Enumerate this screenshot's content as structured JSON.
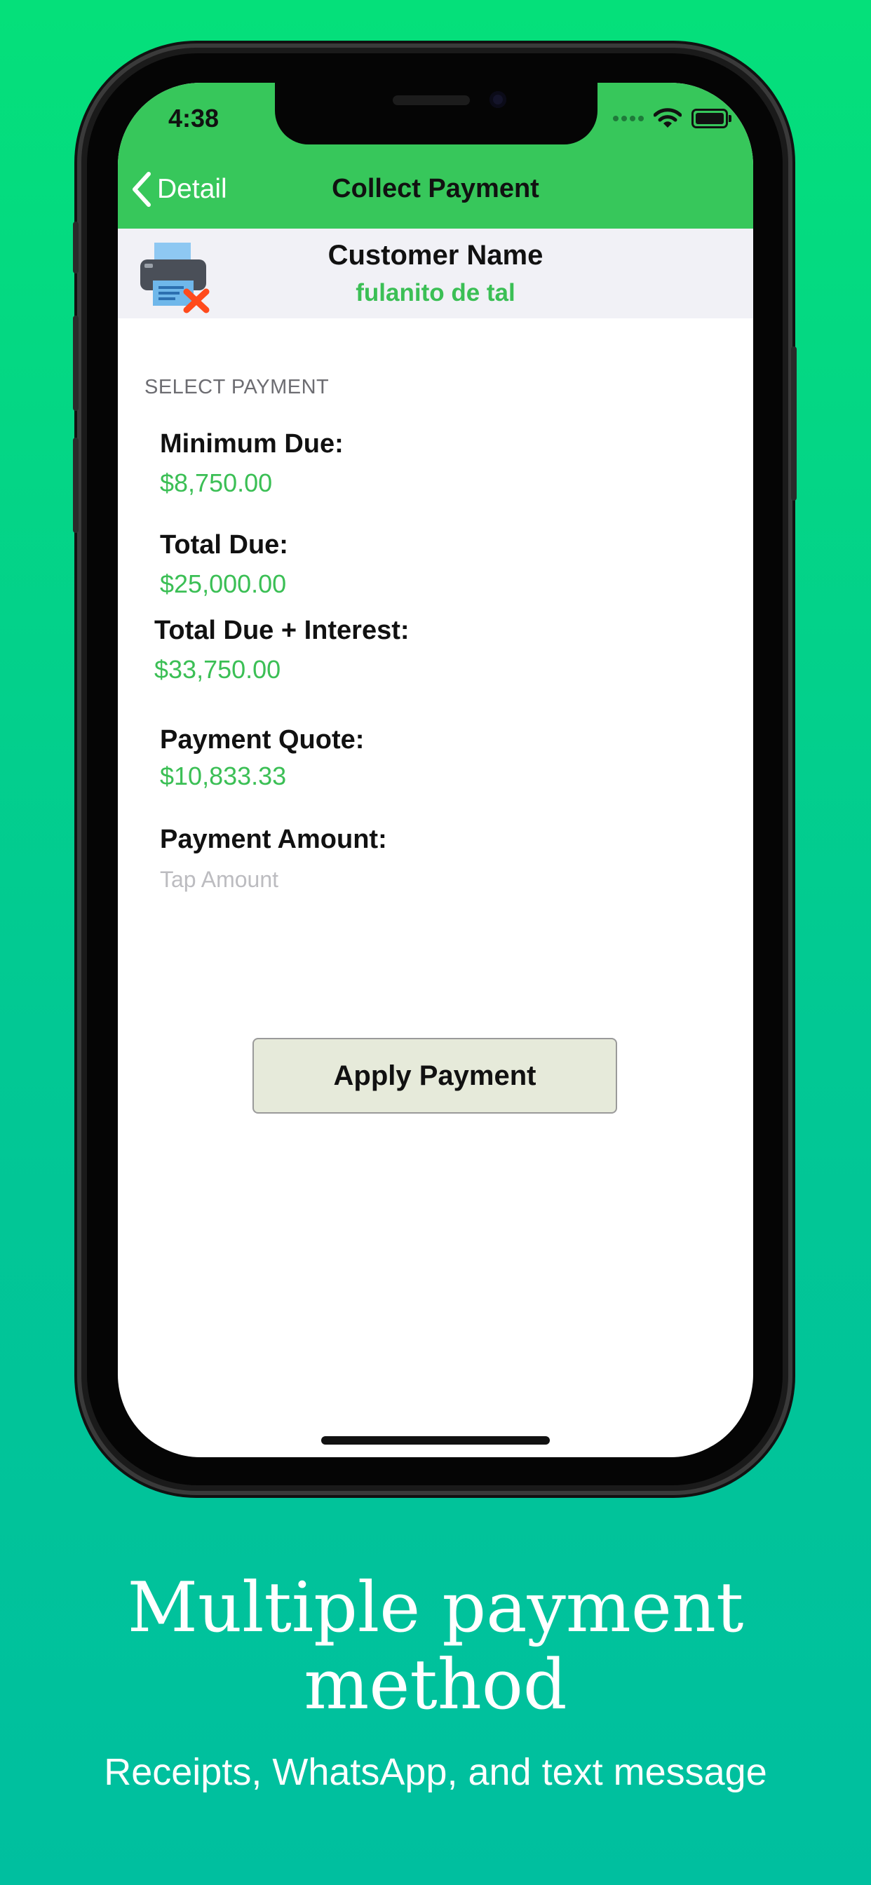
{
  "status_bar": {
    "time": "4:38"
  },
  "nav": {
    "back_label": "Detail",
    "title": "Collect Payment"
  },
  "customer": {
    "label": "Customer Name",
    "name": "fulanito de tal"
  },
  "section": {
    "header": "SELECT PAYMENT"
  },
  "fields": [
    {
      "label": "Minimum Due:",
      "value": "$8,750.00"
    },
    {
      "label": "Total Due:",
      "value": "$25,000.00"
    },
    {
      "label": "Total Due + Interest:",
      "value": "$33,750.00"
    },
    {
      "label": "Payment Quote:",
      "value": "$10,833.33"
    }
  ],
  "payment_amount": {
    "label": "Payment Amount:",
    "placeholder": "Tap Amount"
  },
  "apply_button": {
    "label": "Apply Payment"
  },
  "caption": {
    "headline_line1": "Multiple payment",
    "headline_line2": "method",
    "subline": "Receipts, WhatsApp, and text message"
  },
  "colors": {
    "nav_green": "#37c75b",
    "value_green": "#3bbf55",
    "button_bg": "#e6eada",
    "background_top": "#05e07a",
    "background_bottom": "#00bf9f"
  },
  "icons": [
    "chevron-left-icon",
    "wifi-icon",
    "battery-icon",
    "printer-error-icon"
  ]
}
